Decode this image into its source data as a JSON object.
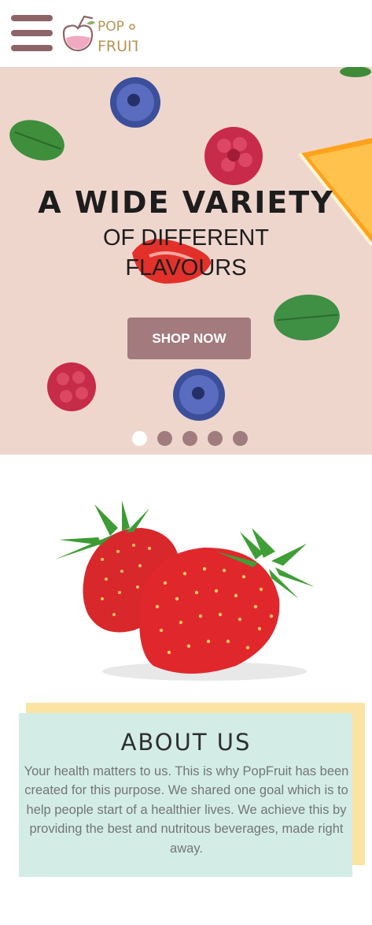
{
  "header": {
    "menu_icon": "hamburger-menu-icon",
    "logo_text_line1": "POP",
    "logo_text_line2": "FRUIT",
    "brand_color": "#8c6468"
  },
  "hero": {
    "title": "A WIDE VARIETY",
    "subtitle_line1": "OF DIFFERENT",
    "subtitle_line2": "FLAVOURS",
    "button_label": "SHOP NOW",
    "slide_count": 5,
    "active_slide": 1,
    "background": "#efd6cd",
    "button_color": "#a37a7d"
  },
  "about": {
    "title": "ABOUT US",
    "text": "Your health matters to us. This is why PopFruit has been created for this purpose. We shared one goal which is to help people start of a healthier lives. We achieve this by providing the best and nutritous beverages, made right away.",
    "panel_color": "#d3ede6",
    "accent_color": "#fbe3a3"
  }
}
